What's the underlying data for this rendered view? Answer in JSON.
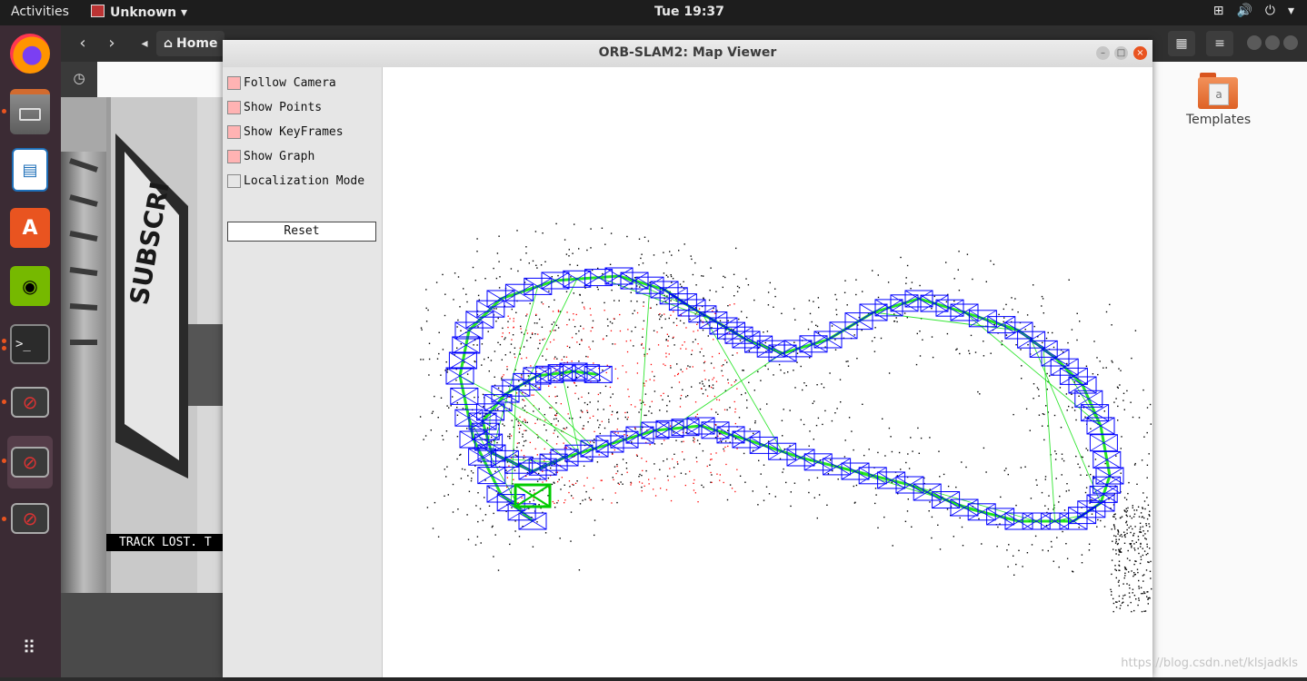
{
  "topbar": {
    "activities": "Activities",
    "app_name": "Unknown",
    "clock": "Tue 19:37",
    "tray_icons": [
      "network-icon",
      "volume-icon",
      "power-icon",
      "chevron-down-icon"
    ]
  },
  "dock": {
    "items": [
      {
        "name": "firefox",
        "running": false
      },
      {
        "name": "files",
        "running": true
      },
      {
        "name": "libreoffice-writer",
        "running": false
      },
      {
        "name": "ubuntu-software",
        "running": false
      },
      {
        "name": "nvidia-settings",
        "running": false
      },
      {
        "name": "terminal",
        "running": true
      },
      {
        "name": "unknown-app-1",
        "running": true
      },
      {
        "name": "unknown-app-2",
        "running": true,
        "active": true
      },
      {
        "name": "unknown-app-3",
        "running": true
      }
    ],
    "show_apps_icon": "grid-icon"
  },
  "file_manager": {
    "location": "Home",
    "folder": {
      "label": "Templates",
      "glyph": "a"
    }
  },
  "camera_frame": {
    "status": "TRACK LOST. T"
  },
  "viewer": {
    "title": "ORB-SLAM2: Map Viewer",
    "options": [
      {
        "label": "Follow Camera",
        "checked": true
      },
      {
        "label": "Show Points",
        "checked": true
      },
      {
        "label": "Show KeyFrames",
        "checked": true
      },
      {
        "label": "Show Graph",
        "checked": true
      },
      {
        "label": "Localization Mode",
        "checked": false
      }
    ],
    "reset_label": "Reset",
    "colors": {
      "keyframe": "#0000ff",
      "graph": "#00e000",
      "current_camera": "#00cc00",
      "map_point": "#000000",
      "local_point": "#ff0000"
    }
  },
  "watermark": "https://blog.csdn.net/klsjadkls"
}
